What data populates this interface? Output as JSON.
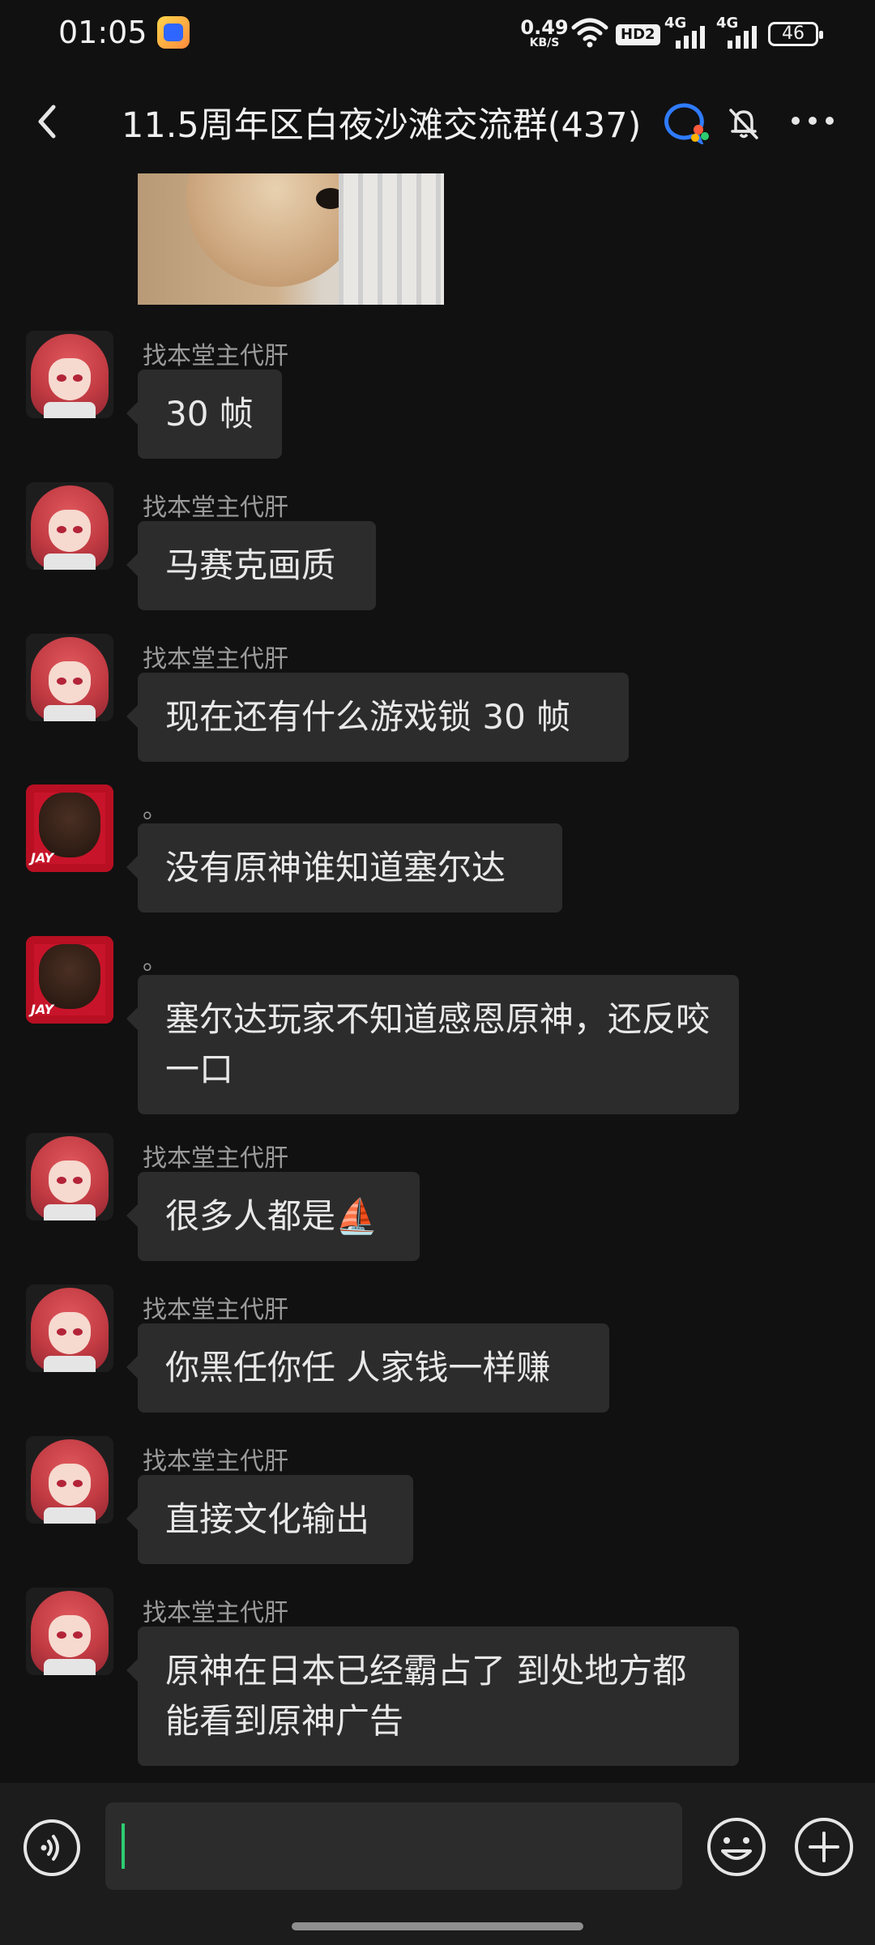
{
  "status_bar": {
    "time": "01:05",
    "net_speed_value": "0.49",
    "net_speed_unit": "KB/S",
    "hd_label": "HD2",
    "signal1_label": "4G",
    "signal2_label": "4G",
    "battery_level": "46"
  },
  "header": {
    "title": "11.5周年区白夜沙滩交流群(437)"
  },
  "messages": [
    {
      "sender": "找本堂主代肝",
      "text": "30 帧",
      "avatar": "red-hair-girl-avatar"
    },
    {
      "sender": "找本堂主代肝",
      "text": "马赛克画质",
      "avatar": "red-hair-girl-avatar"
    },
    {
      "sender": "找本堂主代肝",
      "text": "现在还有什么游戏锁 30 帧",
      "avatar": "red-hair-girl-avatar"
    },
    {
      "sender": "。",
      "text": "没有原神谁知道塞尔达",
      "avatar": "red-hood-man-avatar"
    },
    {
      "sender": "。",
      "text": "塞尔达玩家不知道感恩原神，还反咬一口",
      "avatar": "red-hood-man-avatar"
    },
    {
      "sender": "找本堂主代肝",
      "text": "很多人都是⛵",
      "avatar": "red-hair-girl-avatar"
    },
    {
      "sender": "找本堂主代肝",
      "text": "你黑任你任 人家钱一样赚",
      "avatar": "red-hair-girl-avatar"
    },
    {
      "sender": "找本堂主代肝",
      "text": "直接文化输出",
      "avatar": "red-hair-girl-avatar"
    },
    {
      "sender": "找本堂主代肝",
      "text": "原神在日本已经霸占了 到处地方都能看到原神广告",
      "avatar": "red-hair-girl-avatar"
    }
  ],
  "input": {
    "value": ""
  },
  "colors": {
    "background": "#111111",
    "bubble": "#2c2c2c",
    "cursor": "#2ecc71"
  }
}
